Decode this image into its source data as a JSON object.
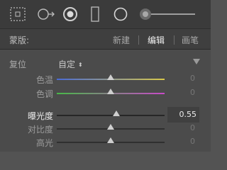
{
  "toolbar": {
    "tools": [
      {
        "name": "marquee-icon"
      },
      {
        "name": "radial-filter-icon"
      },
      {
        "name": "brush-icon"
      },
      {
        "name": "rectangle-icon"
      },
      {
        "name": "circle-icon"
      },
      {
        "name": "feather-slider-icon"
      }
    ]
  },
  "header": {
    "mask_label": "蒙版:",
    "new_label": "新建",
    "edit_label": "编辑",
    "brush_label": "画笔"
  },
  "panel": {
    "reset_label": "复位",
    "preset_value": "自定",
    "preset_arrows": "◆",
    "sliders": [
      {
        "label": "色温",
        "value": "0",
        "position": 0.5,
        "track": "temperature",
        "active": false
      },
      {
        "label": "色调",
        "value": "0",
        "position": 0.5,
        "track": "tint",
        "active": false
      },
      {
        "label": "曝光度",
        "value": "0.55",
        "position": 0.55,
        "track": "plain",
        "active": true
      },
      {
        "label": "对比度",
        "value": "0",
        "position": 0.5,
        "track": "plain",
        "active": false
      },
      {
        "label": "高光",
        "value": "0",
        "position": 0.5,
        "track": "plain",
        "active": false
      }
    ]
  },
  "colors": {
    "toolbar_bg": "#3b3b3b",
    "header_bg": "#3f3f3f",
    "panel_bg": "#4b4b4b",
    "temperature_start": "#4a6bd6",
    "temperature_end": "#d8c84a",
    "tint_start": "#48b848",
    "tint_end": "#c84ac8"
  }
}
